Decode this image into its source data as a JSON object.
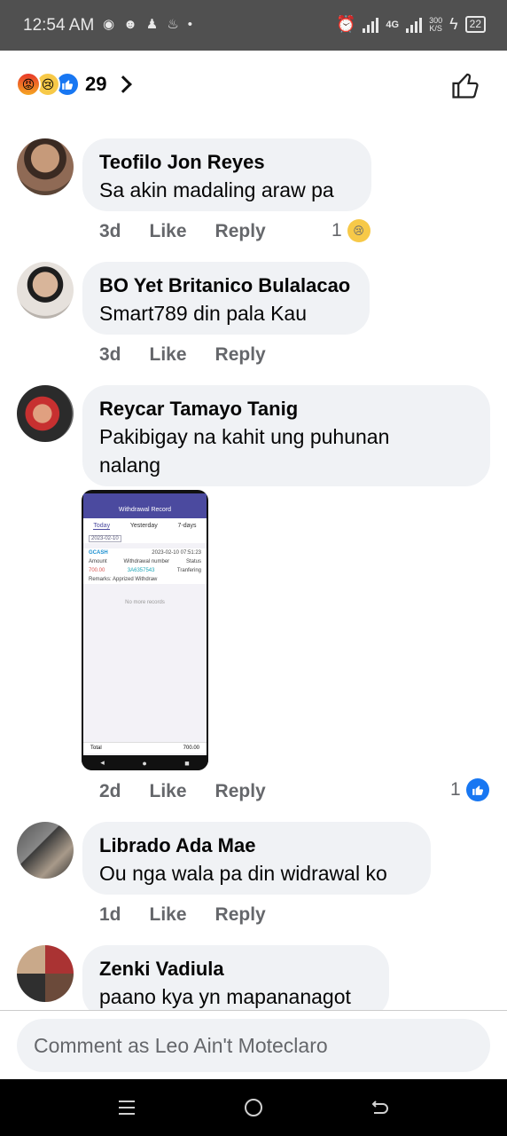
{
  "status_bar": {
    "time": "12:54 AM",
    "network": "4G",
    "speed": "300",
    "speed_unit": "K/S",
    "battery": "22"
  },
  "reactions": {
    "count": "29"
  },
  "comments": [
    {
      "author": "Teofilo Jon Reyes",
      "text": "Sa akin madaling araw pa",
      "age": "3d",
      "like_label": "Like",
      "reply_label": "Reply",
      "reaction_count": "1",
      "reaction_type": "sad-icon"
    },
    {
      "author": "BO Yet Britanico Bulalacao",
      "text": "Smart789 din pala Kau",
      "age": "3d",
      "like_label": "Like",
      "reply_label": "Reply"
    },
    {
      "author": "Reycar Tamayo Tanig",
      "text_line1": "Pakibigay na kahit ung puhunan",
      "text_line2": "nalang",
      "age": "2d",
      "like_label": "Like",
      "reply_label": "Reply",
      "reaction_count": "1",
      "reaction_type": "like-icon",
      "attachment": {
        "header": "Withdrawal Record",
        "tabs": [
          "Today",
          "Yesterday",
          "7-days"
        ],
        "date": "2023-02-10",
        "provider": "GCASH",
        "timestamp": "2023-02-10 07:51:23",
        "col_amount": "Amount",
        "col_number": "Withdrawal number",
        "col_status": "Status",
        "amount": "700.00",
        "number": "3A6357543",
        "status": "Tranfering",
        "remark": "Remarks: Apprized Withdraw",
        "empty": "No more records",
        "total_label": "Total",
        "total_value": "700.00"
      }
    },
    {
      "author": "Librado Ada Mae",
      "text": "Ou nga wala pa din widrawal ko",
      "age": "1d",
      "like_label": "Like",
      "reply_label": "Reply"
    },
    {
      "author": "Zenki Vadiula",
      "text": "paano kya yn mapananagot"
    }
  ],
  "composer": {
    "placeholder": "Comment as Leo Ain't Moteclaro"
  },
  "colors": {
    "brand_blue": "#1877f2",
    "bubble_bg": "#f0f2f5",
    "meta_gray": "#65676b"
  }
}
